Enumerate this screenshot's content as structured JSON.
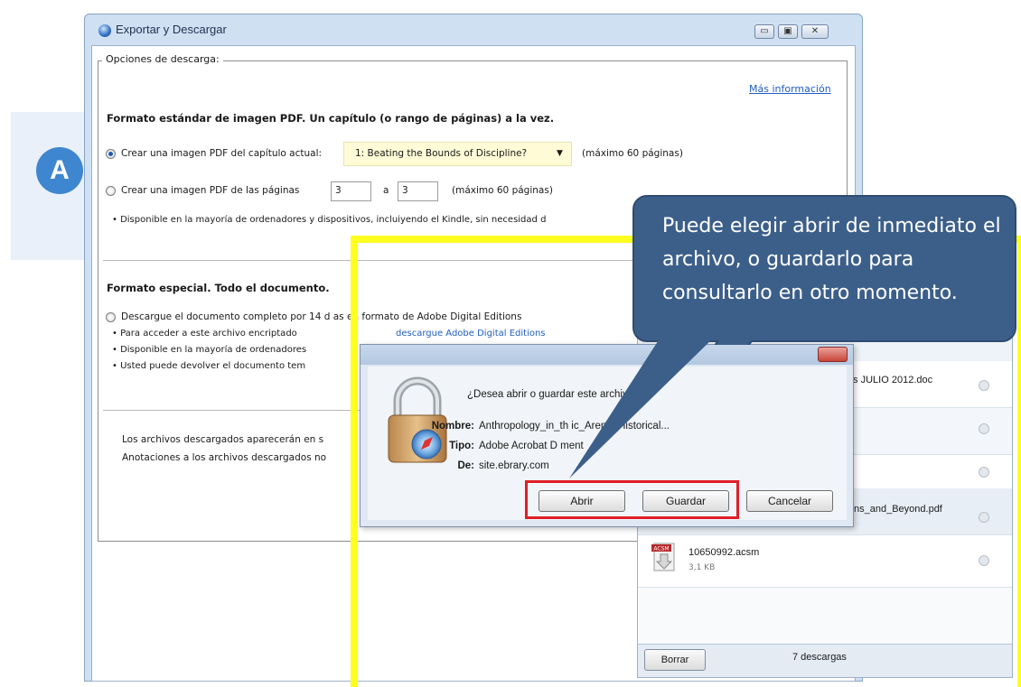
{
  "badge": {
    "letter": "A"
  },
  "window": {
    "title": "Exportar y Descargar",
    "controls": {
      "minimize": "▭",
      "maximize": "▣",
      "close": "✕"
    }
  },
  "options": {
    "legend": "Opciones de descarga:",
    "more_info_link": "Más información",
    "section1": {
      "heading": "Formato estándar de imagen PDF. Un capítulo (o rango de páginas) a la vez.",
      "chapter_radio_label": "Crear una imagen PDF del capítulo actual:",
      "chapter_selected": "1: Beating the Bounds of Discipline?",
      "chapter_max": "(máximo 60 páginas)",
      "pages_radio_label": "Crear una imagen PDF de las páginas",
      "page_from": "3",
      "page_to_label": "a",
      "page_to": "3",
      "pages_max": "(máximo 60 páginas)",
      "bullet": "• Disponible en la mayoría de ordenadores y dispositivos, incluiyendo el Kindle, sin necesidad d"
    },
    "section2": {
      "heading": "Formato especial. Todo el documento.",
      "doc_radio_label": "Descargue el documento completo por 14 d   as en formato de Adobe Digital Editions",
      "bullet_1": "• Para acceder a este archivo encriptado",
      "bullet_1_link": "descargue Adobe Digital Editions",
      "bullet_2": "• Disponible en la mayoría de ordenadores",
      "bullet_3": "• Usted puede devolver el documento tem"
    },
    "footer_line_1": "Los archivos descargados aparecerán en s",
    "footer_line_2": "Anotaciones a los archivos descargados no"
  },
  "callout": {
    "text": "Puede elegir abrir de inmediato el archivo, o guardarlo para consultarlo en otro momento."
  },
  "dialog": {
    "question": "¿Desea abrir o guardar este archivo",
    "name_label": "Nombre:",
    "name_value": "Anthropology_in_th       ic_Arena_Historical...",
    "type_label": "Tipo:",
    "type_value": "Adobe Acrobat D         ment",
    "from_label": "De:",
    "from_value": "site.ebrary.com",
    "open_button": "Abrir",
    "save_button": "Guardar",
    "cancel_button": "Cancelar"
  },
  "downloads": {
    "item_1_name": "icos JULIO 2012.doc",
    "item_2_name": "ns_and_Beyond.pdf",
    "item_3_name": "10650992.acsm",
    "item_3_size": "3,1 KB",
    "acsm_icon_label": "ACSM",
    "clear_button": "Borrar",
    "count": "7 descargas"
  },
  "colors": {
    "accent_blue": "#3e86cf",
    "callout_blue": "#3c5f8a",
    "highlight_yellow": "#ffff1f",
    "highlight_red": "#e01e26",
    "link_blue": "#1f5ec2"
  }
}
